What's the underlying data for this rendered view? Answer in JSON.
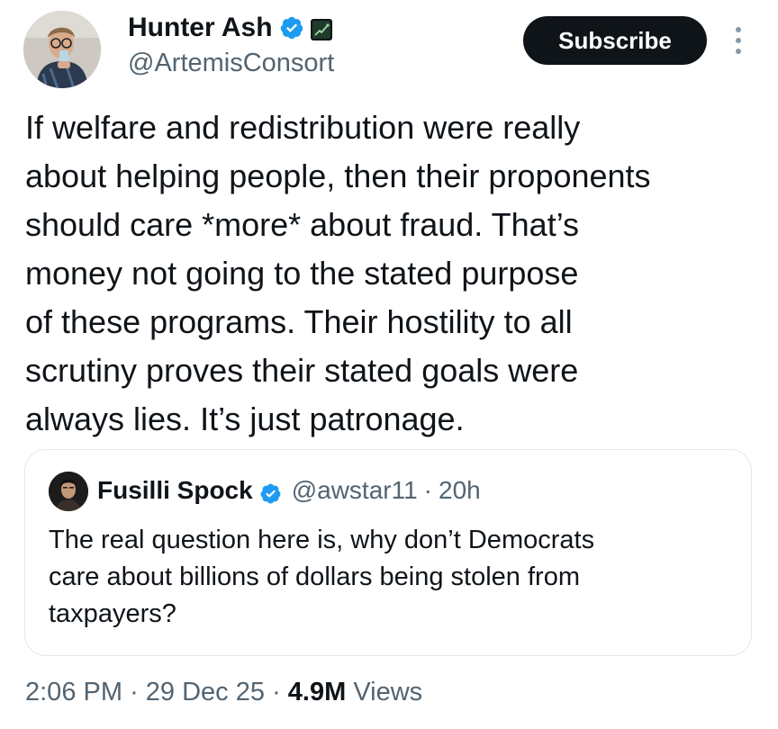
{
  "author": {
    "name": "Hunter Ash",
    "handle": "@ArtemisConsort"
  },
  "subscribe_button": {
    "label": "Subscribe"
  },
  "tweet": {
    "lines": [
      "If welfare and redistribution were really",
      "about helping people, then their proponents",
      "should care *more* about fraud. That’s",
      "money not going to the stated purpose",
      "of these programs. Their hostility to all",
      "scrutiny proves their stated goals were",
      "always lies. It’s just patronage."
    ]
  },
  "quote": {
    "name": "Fusilli Spock",
    "handle": "@awstar11",
    "separator": "·",
    "time": "20h",
    "lines": [
      "The real question here is, why don’t Democrats",
      "care about billions of dollars being stolen from",
      "taxpayers?"
    ]
  },
  "meta": {
    "time": "2:06 PM",
    "separator": "·",
    "date": "29 Dec 25",
    "views_count": "4.9M",
    "views_label": "Views"
  },
  "icons": {
    "verified": "verified-badge-icon",
    "affiliation": "affiliation-badge-icon",
    "more": "more-vertical-icon"
  },
  "colors": {
    "verified_blue": "#1d9bf0",
    "button_bg": "#0f1419",
    "secondary_text": "#536471",
    "border": "#e1e8ed"
  }
}
